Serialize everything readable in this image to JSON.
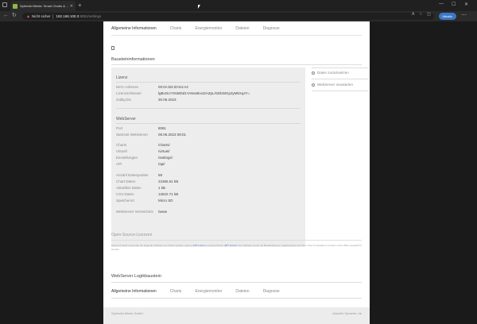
{
  "browser": {
    "tab_title": "Splendid Minds: Smart Charts & ...",
    "address_warning": "Nicht sicher",
    "url_host": "192.168.100.3",
    "url_path": ":8081/settings",
    "update_button": "Aktualis.",
    "colors": {
      "accent": "#3b78c4"
    }
  },
  "topnav": {
    "items": [
      "Allgemeine Informationen",
      "Charts",
      "Energiemonitor",
      "Dateien",
      "Diagnose"
    ]
  },
  "baustein": {
    "title": "Baustein­informationen"
  },
  "lizenz": {
    "title": "Lizenz",
    "rows": [
      {
        "label": "MAC-Adresse",
        "value": "00:0A:B3:20:64:A2"
      },
      {
        "label": "Lizenzschlüssel",
        "value": "lgBxOcrY0sMDd1YA5vsBnoDAZpL/GEbWGp3yMkXq4Y="
      },
      {
        "label": "Gültig bis",
        "value": "30.06.2023"
      }
    ]
  },
  "webserver": {
    "title": "WebServer",
    "rows_a": [
      {
        "label": "Port",
        "value": "8081"
      },
      {
        "label": "Startzeit WebServer",
        "value": "08.06.2023 08:01"
      }
    ],
    "rows_b": [
      {
        "label": "Charts",
        "value": "/charts/"
      },
      {
        "label": "Virtuell",
        "value": "/virtuel/"
      },
      {
        "label": "Einstellungen",
        "value": "/settings/"
      },
      {
        "label": "API",
        "value": "/api/"
      }
    ],
    "rows_c": [
      {
        "label": "Anzahl Datenpunkte",
        "value": "58"
      },
      {
        "label": "Chart-Daten",
        "value": "22365.51 kB"
      },
      {
        "label": "Aktuellen Daten",
        "value": "1 kB"
      },
      {
        "label": "CSV-Daten",
        "value": "12622.71 kB"
      },
      {
        "label": "Speicherort",
        "value": "Micro SD"
      }
    ],
    "rows_d": [
      {
        "label": "WebServer Verzeichnis",
        "value": "/www"
      }
    ]
  },
  "side_actions": [
    "Daten zurücksetzen",
    "WebServer neustarten"
  ],
  "oss": {
    "title": "Open-Source-Lizenzen",
    "text_a": "Dieses Produkt verwendet die folgende Software von dritten Quellen: jQuery (",
    "link_a": "MIT Lizenz",
    "text_b": ") und ApexCharts (",
    "link_b": "MIT Lizenz",
    "text_c": "). Die Software wurde als Bestandteil des Logikbausteins auf Ihren Gira X1 installiert und kann somit offline ausgeführt werden."
  },
  "logik": {
    "title": "WebServer Logikbaustein",
    "nav": [
      "Allgemeine Informationen",
      "Charts",
      "Energiemonitor",
      "Dateien",
      "Diagnose"
    ]
  },
  "footer": {
    "left": "Splendid Minds GmbH",
    "right": "Aktuelle Sprache: de"
  }
}
